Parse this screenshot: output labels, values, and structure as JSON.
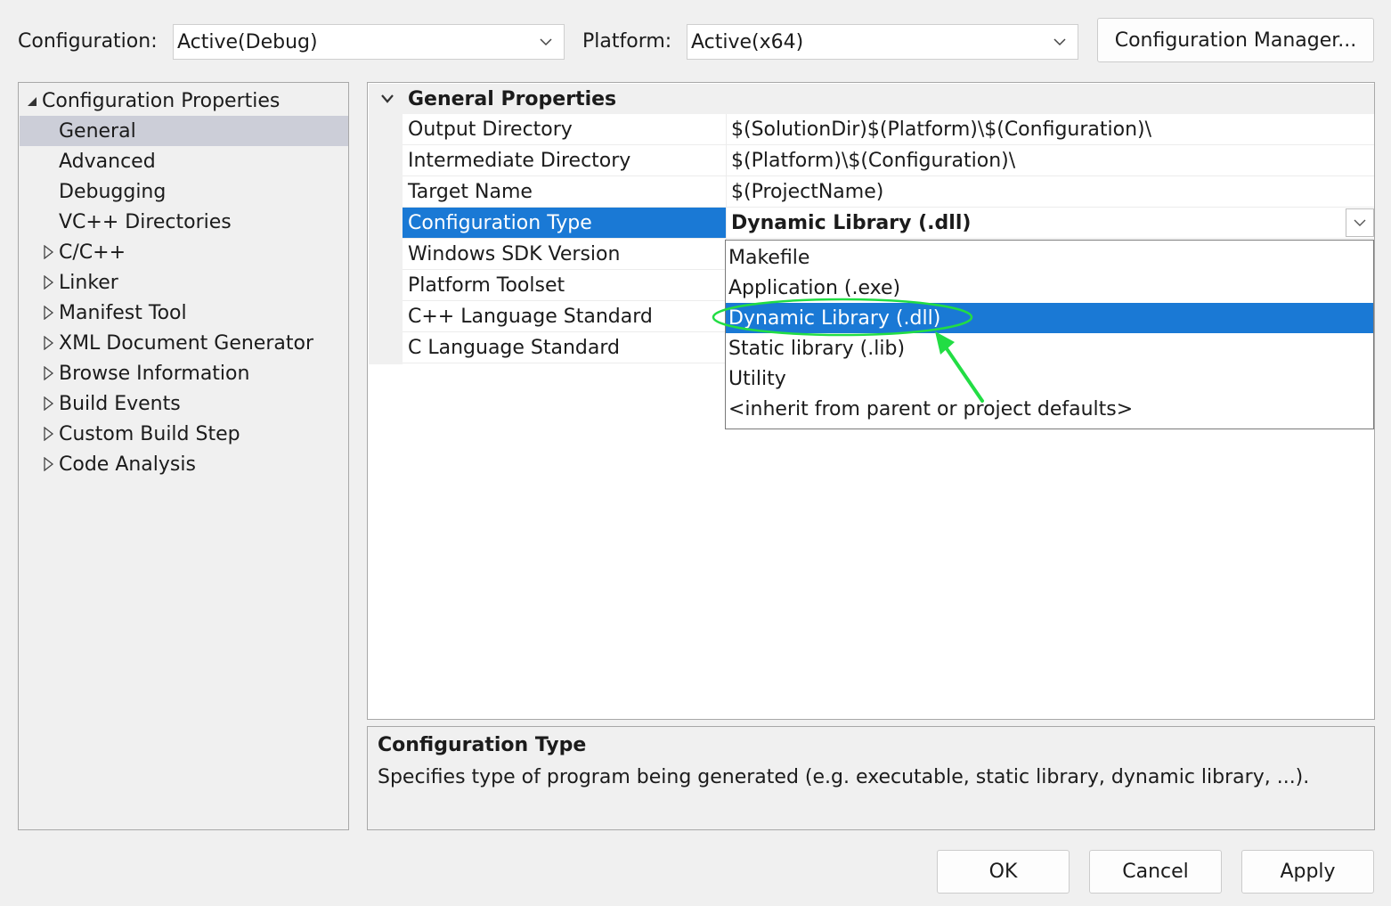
{
  "toolbar": {
    "configuration_label": "Configuration:",
    "configuration_value": "Active(Debug)",
    "platform_label": "Platform:",
    "platform_value": "Active(x64)",
    "config_manager_label": "Configuration Manager..."
  },
  "tree": {
    "root": "Configuration Properties",
    "items": [
      {
        "label": "General",
        "expandable": false,
        "selected": true
      },
      {
        "label": "Advanced",
        "expandable": false
      },
      {
        "label": "Debugging",
        "expandable": false
      },
      {
        "label": "VC++ Directories",
        "expandable": false
      },
      {
        "label": "C/C++",
        "expandable": true
      },
      {
        "label": "Linker",
        "expandable": true
      },
      {
        "label": "Manifest Tool",
        "expandable": true
      },
      {
        "label": "XML Document Generator",
        "expandable": true
      },
      {
        "label": "Browse Information",
        "expandable": true
      },
      {
        "label": "Build Events",
        "expandable": true
      },
      {
        "label": "Custom Build Step",
        "expandable": true
      },
      {
        "label": "Code Analysis",
        "expandable": true
      }
    ]
  },
  "grid": {
    "category": "General Properties",
    "rows": [
      {
        "name": "Output Directory",
        "value": "$(SolutionDir)$(Platform)\\$(Configuration)\\"
      },
      {
        "name": "Intermediate Directory",
        "value": "$(Platform)\\$(Configuration)\\"
      },
      {
        "name": "Target Name",
        "value": "$(ProjectName)"
      },
      {
        "name": "Configuration Type",
        "value": "Dynamic Library (.dll)"
      },
      {
        "name": "Windows SDK Version",
        "value": ""
      },
      {
        "name": "Platform Toolset",
        "value": ""
      },
      {
        "name": "C++ Language Standard",
        "value": ""
      },
      {
        "name": "C Language Standard",
        "value": ""
      }
    ]
  },
  "dropdown": {
    "options": [
      "Makefile",
      "Application (.exe)",
      "Dynamic Library (.dll)",
      "Static library (.lib)",
      "Utility",
      "<inherit from parent or project defaults>"
    ],
    "selected_index": 2
  },
  "description": {
    "title": "Configuration Type",
    "body": "Specifies type of program being generated (e.g. executable, static library, dynamic library, ...)."
  },
  "buttons": {
    "ok": "OK",
    "cancel": "Cancel",
    "apply": "Apply"
  },
  "colors": {
    "selection": "#1a79d5",
    "tree_selection": "#ccced8",
    "annotation": "#22dd44"
  }
}
